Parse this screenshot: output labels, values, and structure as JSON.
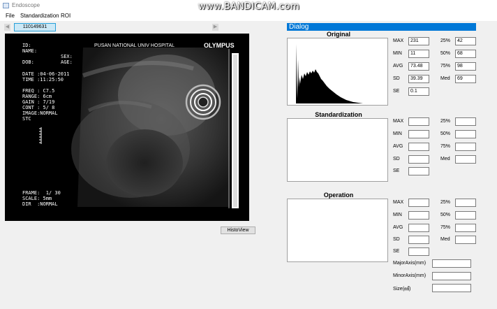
{
  "window": {
    "title": "Endoscope"
  },
  "watermark": "www.BANDICAM.com",
  "menu": {
    "items": [
      "File",
      "Standardization",
      "ROI"
    ]
  },
  "tabs": {
    "current": "110149631"
  },
  "image": {
    "header": "PUSAN NATIONAL UNIV HOSPITAL",
    "brand": "OLYMPUS",
    "id_label": "ID:",
    "name_label": "NAME:",
    "sex_label": "SEX:",
    "dob_label": "DOB:",
    "age_label": "AGE:",
    "date_label": "DATE :04-06-2011",
    "time_label": "TIME :11:25:50",
    "freq": "FREQ : C7.5",
    "range": "RANGE: 6cm",
    "gain": "GAIN : 7/19",
    "cont": "CONT : 5/ 8",
    "image_mode": "IMAGE:NORMAL",
    "stc": "STC",
    "frame": "FRAME:  1/ 30",
    "scale": "SCALE: 5mm",
    "dir": "DIR  :NORMAL"
  },
  "histoview_button": "HistoView",
  "dialog": {
    "title": "Dialog",
    "original": {
      "title": "Original",
      "max_label": "MAX",
      "max": "231",
      "min_label": "MIN",
      "min": "11",
      "avg_label": "AVG",
      "avg": "73.48",
      "sd_label": "SD",
      "sd": "39.39",
      "se_label": "SE",
      "se": "0.1",
      "p25_label": "25%",
      "p25": "42",
      "p50_label": "50%",
      "p50": "68",
      "p75_label": "75%",
      "p75": "98",
      "med_label": "Med",
      "med": "69"
    },
    "standardization": {
      "title": "Standardization",
      "max_label": "MAX",
      "min_label": "MIN",
      "avg_label": "AVG",
      "sd_label": "SD",
      "se_label": "SE",
      "p25_label": "25%",
      "p50_label": "50%",
      "p75_label": "75%",
      "med_label": "Med"
    },
    "operation": {
      "title": "Operation",
      "max_label": "MAX",
      "min_label": "MIN",
      "avg_label": "AVG",
      "sd_label": "SD",
      "se_label": "SE",
      "p25_label": "25%",
      "p50_label": "50%",
      "p75_label": "75%",
      "med_label": "Med",
      "major_label": "MajorAxis(mm)",
      "minor_label": "MinorAxis(mm)",
      "size_label": "Size(㎟)"
    }
  }
}
